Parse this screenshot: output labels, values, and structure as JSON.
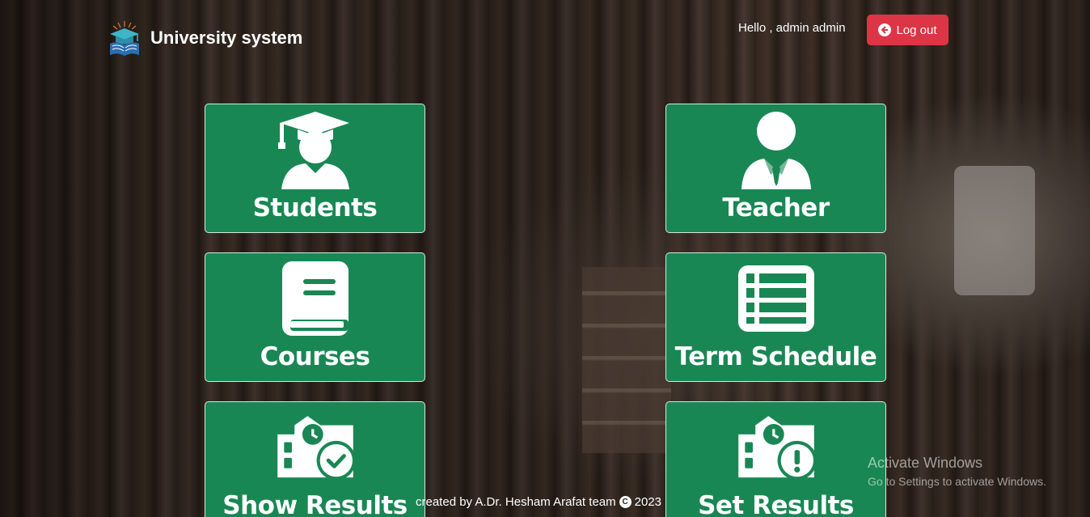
{
  "app": {
    "name": "University system",
    "logo_icon": "graduation-book-logo"
  },
  "header": {
    "greeting": "Hello , admin admin",
    "logout_label": "Log out",
    "logout_icon": "arrow-left-circle-icon",
    "logout_color": "#dc3545"
  },
  "cards": [
    {
      "label": "Students",
      "icon": "student-graduate-icon"
    },
    {
      "label": "Teacher",
      "icon": "teacher-tie-icon"
    },
    {
      "label": "Courses",
      "icon": "book-icon"
    },
    {
      "label": "Term Schedule",
      "icon": "table-list-icon"
    },
    {
      "label": "Show Results",
      "icon": "building-check-icon"
    },
    {
      "label": "Set Results",
      "icon": "building-exclamation-icon"
    }
  ],
  "card_color": "#198754",
  "footer": {
    "text": "created by A.Dr. Hesham Arafat team",
    "year": "2023"
  },
  "watermark": {
    "title": "Activate Windows",
    "subtitle": "Go to Settings to activate Windows."
  }
}
